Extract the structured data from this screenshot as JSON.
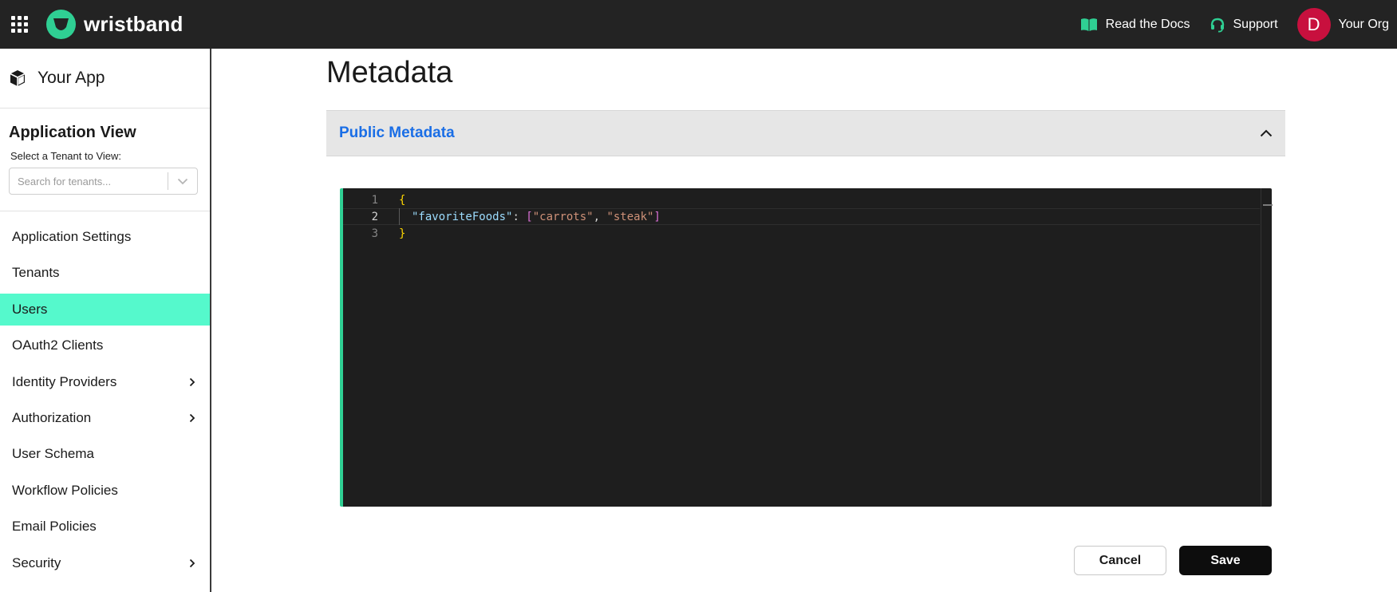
{
  "topbar": {
    "brand": "wristband",
    "docs_label": "Read the Docs",
    "support_label": "Support",
    "org_initial": "D",
    "org_name": "Your Org"
  },
  "sidebar": {
    "app_name": "Your App",
    "view_title": "Application View",
    "tenant_label": "Select a Tenant to View:",
    "tenant_placeholder": "Search for tenants...",
    "items": [
      {
        "label": "Application Settings",
        "has_submenu": false,
        "active": false
      },
      {
        "label": "Tenants",
        "has_submenu": false,
        "active": false
      },
      {
        "label": "Users",
        "has_submenu": false,
        "active": true
      },
      {
        "label": "OAuth2 Clients",
        "has_submenu": false,
        "active": false
      },
      {
        "label": "Identity Providers",
        "has_submenu": true,
        "active": false
      },
      {
        "label": "Authorization",
        "has_submenu": true,
        "active": false
      },
      {
        "label": "User Schema",
        "has_submenu": false,
        "active": false
      },
      {
        "label": "Workflow Policies",
        "has_submenu": false,
        "active": false
      },
      {
        "label": "Email Policies",
        "has_submenu": false,
        "active": false
      },
      {
        "label": "Security",
        "has_submenu": true,
        "active": false
      }
    ]
  },
  "main": {
    "title": "Metadata",
    "accordion_title": "Public Metadata",
    "editor": {
      "line_numbers": [
        "1",
        "2",
        "3"
      ],
      "line1": "{",
      "line2_key": "\"favoriteFoods\"",
      "line2_colon": ": ",
      "line2_open": "[",
      "line2_val1": "\"carrots\"",
      "line2_comma": ", ",
      "line2_val2": "\"steak\"",
      "line2_close": "]",
      "line3": "}"
    },
    "cancel_label": "Cancel",
    "save_label": "Save"
  },
  "colors": {
    "topbar_bg": "#232323",
    "brand_accent": "#2fcf93",
    "active_nav": "#55f9cc",
    "accordion_title": "#1a6ee6",
    "avatar": "#c8103e",
    "editor_bg": "#1e1e1e"
  }
}
